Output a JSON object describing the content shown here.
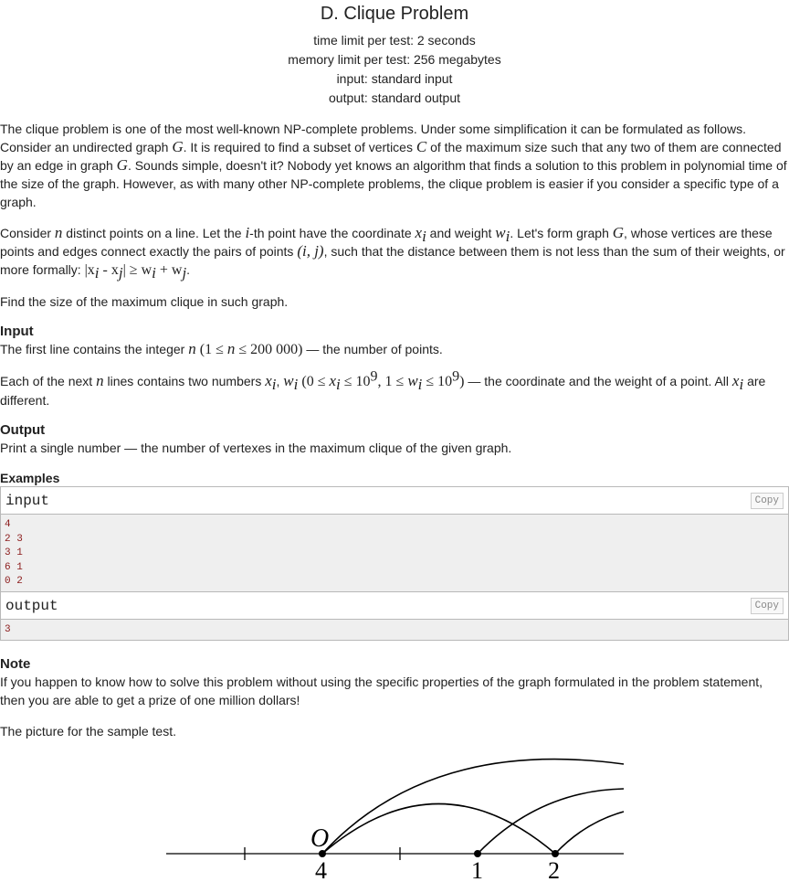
{
  "header": {
    "title": "D. Clique Problem",
    "time_limit": "time limit per test: 2 seconds",
    "memory_limit": "memory limit per test: 256 megabytes",
    "input": "input: standard input",
    "output": "output: standard output"
  },
  "statement": {
    "p1a": "The clique problem is one of the most well-known NP-complete problems. Under some simplification it can be formulated as follows. Consider an undirected graph ",
    "p1b": ". It is required to find a subset of vertices ",
    "p1c": " of the maximum size such that any two of them are connected by an edge in graph ",
    "p1d": ". Sounds simple, doesn't it? Nobody yet knows an algorithm that finds a solution to this problem in polynomial time of the size of the graph. However, as with many other NP-complete problems, the clique problem is easier if you consider a specific type of a graph.",
    "G": "G",
    "C": "C",
    "p2a": "Consider ",
    "n": "n",
    "p2b": " distinct points on a line. Let the ",
    "i": "i",
    "p2c": "-th point have the coordinate ",
    "x": "x",
    "p2d": " and weight ",
    "w": "w",
    "p2e": ". Let's form graph ",
    "p2f": ", whose vertices are these points and edges connect exactly the pairs of points ",
    "pair": "(i, j)",
    "p2g": ", such that the distance between them is not less than the sum of their weights, or more formally: ",
    "formula_abs": "|x",
    "formula_mid": " - x",
    "formula_end": "| ≥ w",
    "formula_plus": " + w",
    "j": "j",
    "period": ".",
    "p3": "Find the size of the maximum clique in such graph."
  },
  "input_section": {
    "title": "Input",
    "l1a": "The first line contains the integer ",
    "l1b": " (1 ≤ ",
    "l1c": " ≤ 200 000)",
    "l1d": " — the number of points.",
    "l2a": "Each of the next ",
    "l2b": " lines contains two numbers ",
    "comma": ", ",
    "l2c": " (0 ≤ ",
    "le": " ≤ 10",
    "nine": "9",
    "l2d": ", 1 ≤ ",
    "close": ")",
    "l2e": " — the coordinate and the weight of a point. All ",
    "l2f": " are different."
  },
  "output_section": {
    "title": "Output",
    "text": "Print a single number — the number of vertexes in the maximum clique of the given graph."
  },
  "examples": {
    "title": "Examples",
    "input_label": "input",
    "output_label": "output",
    "copy_label": "Copy",
    "input_text": "4\n2 3\n3 1\n6 1\n0 2",
    "output_text": "3"
  },
  "note": {
    "title": "Note",
    "text": "If you happen to know how to solve this problem without using the specific properties of the graph formulated in the problem statement, then you are able to get a prize of one million dollars!",
    "picture_caption": "The picture for the sample test."
  },
  "figure": {
    "origin_label": "O",
    "point_labels": [
      "4",
      "1",
      "2"
    ]
  }
}
